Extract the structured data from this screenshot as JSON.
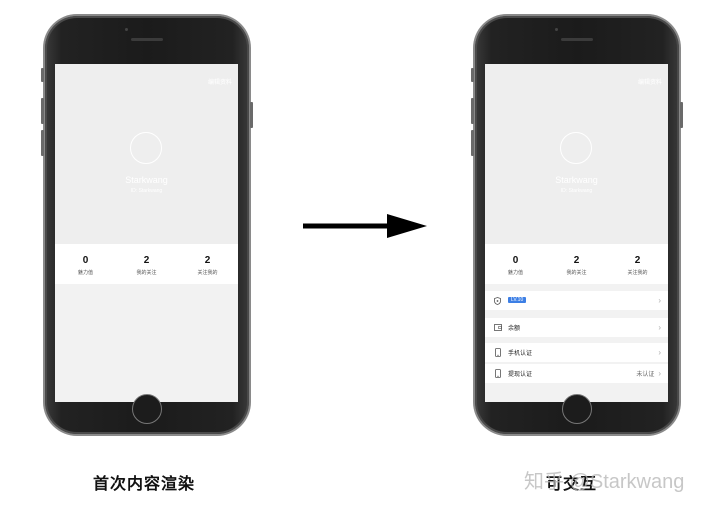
{
  "phones": [
    {
      "edit_label": "编辑资料",
      "username": "Starkwang",
      "user_id": "ID: Starkwang",
      "stats": [
        {
          "value": "0",
          "label": "魅力值"
        },
        {
          "value": "2",
          "label": "我的关注"
        },
        {
          "value": "2",
          "label": "关注我的"
        }
      ],
      "caption": "首次内容渲染"
    },
    {
      "edit_label": "编辑资料",
      "username": "Starkwang",
      "user_id": "ID: Starkwang",
      "stats": [
        {
          "value": "0",
          "label": "魅力值"
        },
        {
          "value": "2",
          "label": "我的关注"
        },
        {
          "value": "2",
          "label": "关注我的"
        }
      ],
      "menu": [
        {
          "icon": "shield-icon",
          "label": "",
          "badge": "LV.10",
          "value": ""
        },
        {
          "icon": "wallet-icon",
          "label": "余额",
          "badge": "",
          "value": ""
        },
        {
          "icon": "phone-icon",
          "label": "手机认证",
          "badge": "",
          "value": ""
        },
        {
          "icon": "phone-icon",
          "label": "提现认证",
          "badge": "",
          "value": "未认证"
        }
      ],
      "caption": "可交互"
    }
  ],
  "watermark": "知乎 @Starkwang",
  "colors": {
    "badge": "#3d7fe5",
    "header_bg": "#eeeeee",
    "phone_body": "#1b1b1b"
  }
}
